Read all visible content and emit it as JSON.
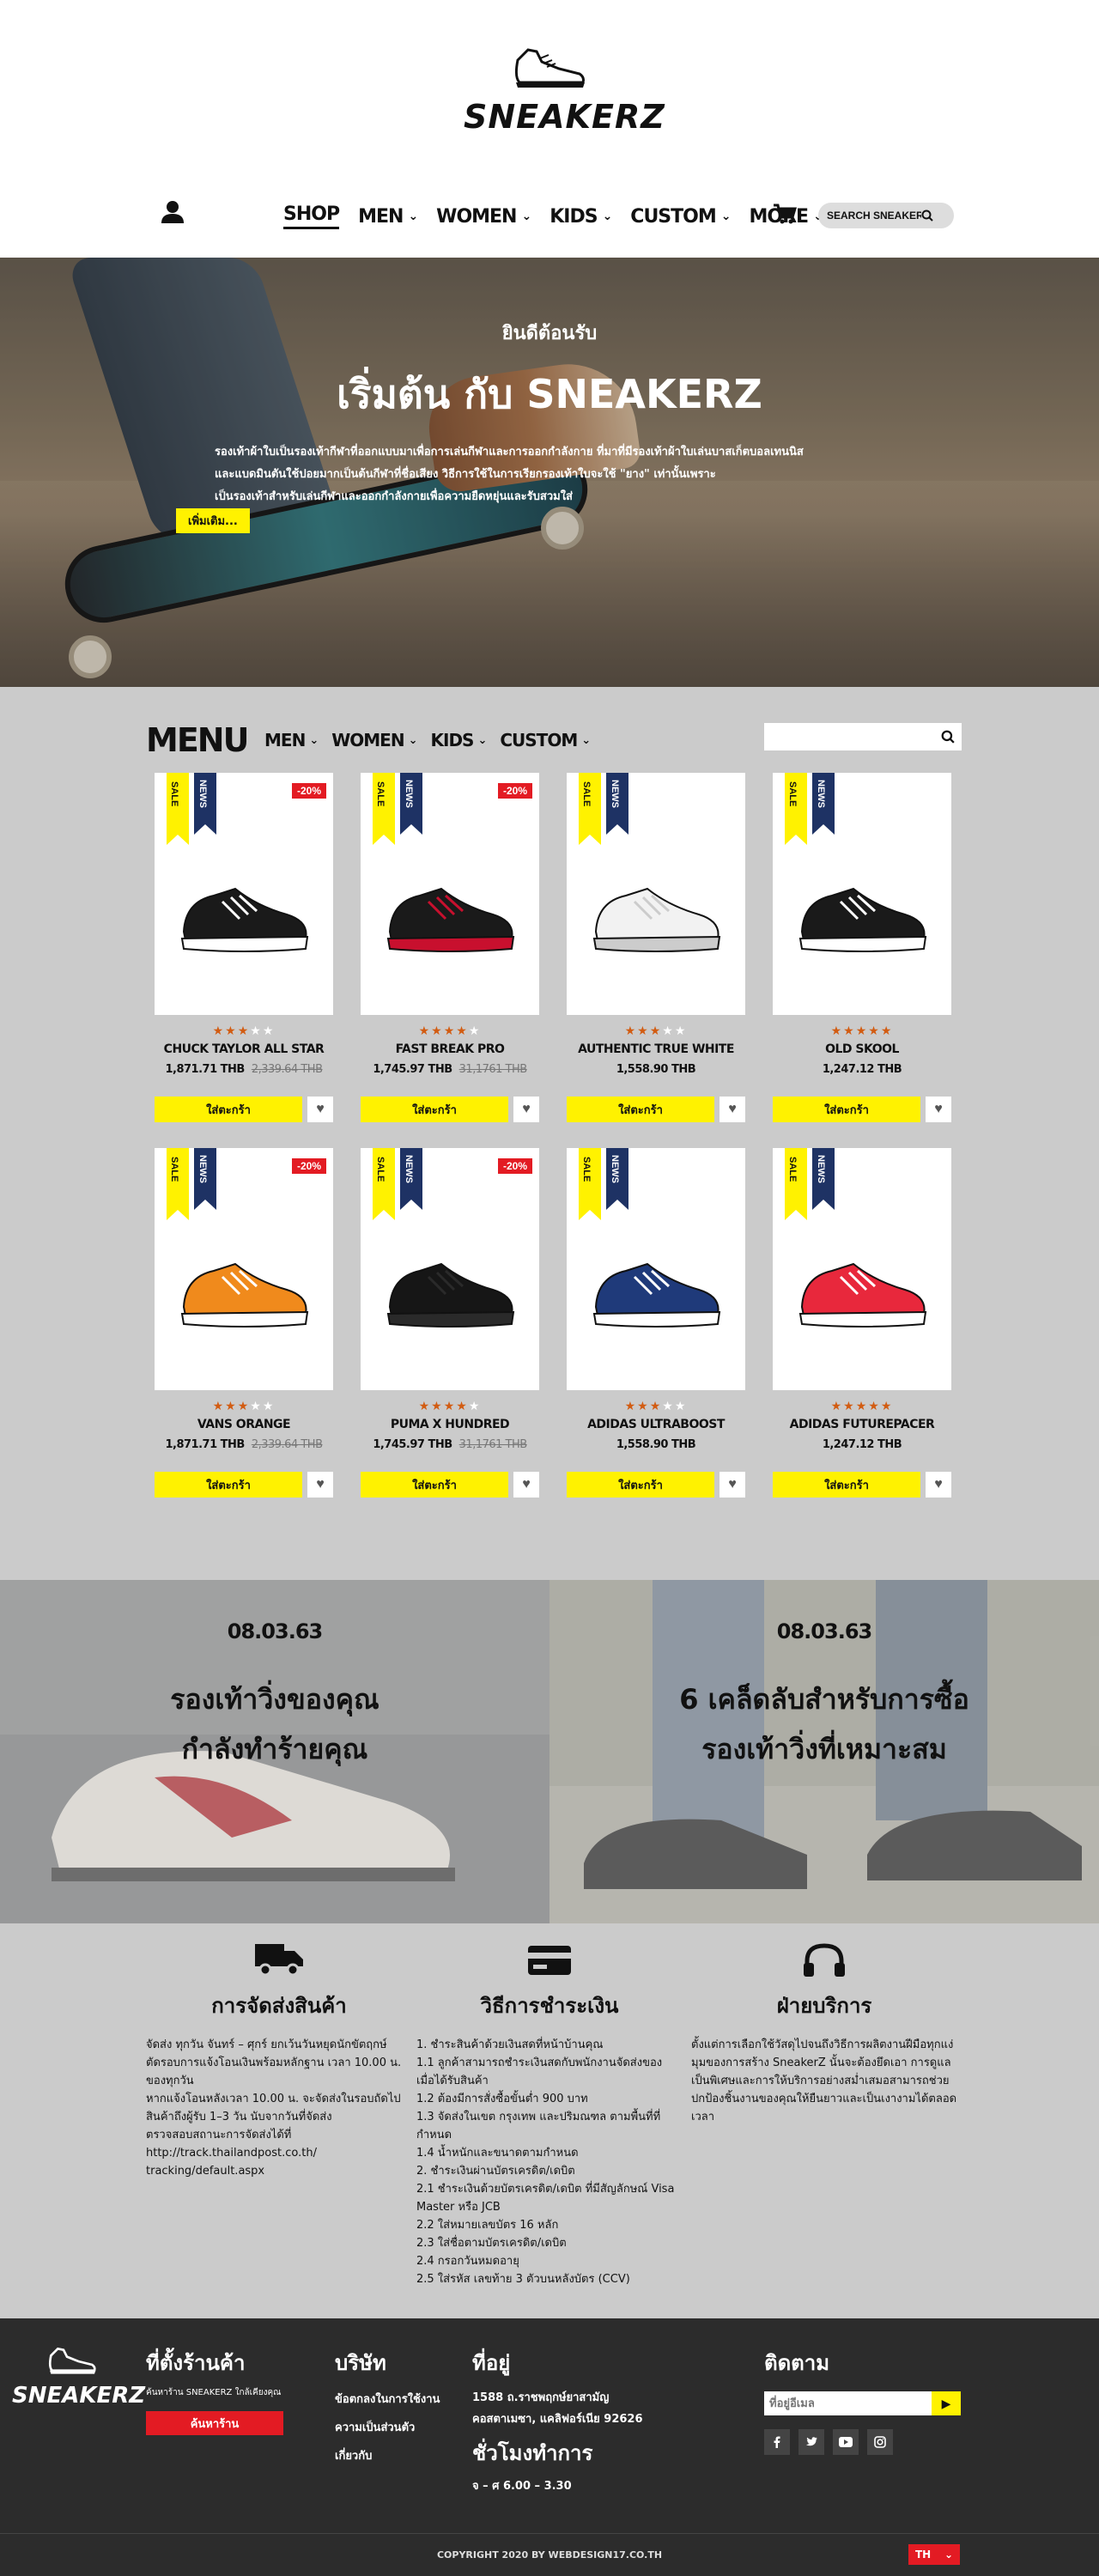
{
  "brand": {
    "name": "SNEAKERZ"
  },
  "nav": {
    "items": [
      {
        "label": "SHOP",
        "chevron": false
      },
      {
        "label": "MEN",
        "chevron": true
      },
      {
        "label": "WOMEN",
        "chevron": true
      },
      {
        "label": "KIDS",
        "chevron": true
      },
      {
        "label": "CUSTOM",
        "chevron": true
      },
      {
        "label": "MORE",
        "chevron": true
      }
    ],
    "search_placeholder": "SEARCH SNEAKERZ"
  },
  "hero": {
    "welcome": "ยินดีต้อนรับ",
    "title": "เริ่มต้น กับ SNEAKERZ",
    "description_lines": [
      "รองเท้าผ้าใบเป็นรองเท้ากีฬาที่ออกแบบมาเพื่อการเล่นกีฬาและการออกกำลังกาย ที่มาที่มีรองเท้าผ้าใบเล่นบาสเก็ตบอลเทนนิส",
      "และแบดมินตันใช้ปอยมากเป็นต้นกีฬาที่ชื่อเสียง วิธีการใช้ในการเรียกรองเท้าใบจะใช้ \"ยาง\" เท่านั้นเพราะ",
      "เป็นรองเท้าสำหรับเล่นกีฬาและออกกำลังกายเพื่อความยืดหยุ่นและรับสวมใส่"
    ],
    "button": "เพิ่มเติม..."
  },
  "menu": {
    "title": "MENU",
    "nav": [
      "MEN",
      "WOMEN",
      "KIDS",
      "CUSTOM"
    ],
    "search_placeholder": ""
  },
  "products": [
    {
      "name": "CHUCK TAYLOR ALL STAR",
      "price": "1,871.71 THB",
      "old_price": "2,339.64 THB",
      "discount": "-20%",
      "rating": 3,
      "color": "#1a1a1a",
      "accent": "#ffffff"
    },
    {
      "name": "FAST BREAK PRO",
      "price": "1,745.97 THB",
      "old_price": "31,1761 THB",
      "discount": "-20%",
      "rating": 4,
      "color": "#1a1a1a",
      "accent": "#c8102e"
    },
    {
      "name": "AUTHENTIC TRUE WHITE",
      "price": "1,558.90 THB",
      "old_price": "",
      "discount": "",
      "rating": 3,
      "color": "#f2f2f2",
      "accent": "#cccccc"
    },
    {
      "name": "OLD SKOOL",
      "price": "1,247.12 THB",
      "old_price": "",
      "discount": "",
      "rating": 5,
      "color": "#1a1a1a",
      "accent": "#ffffff"
    },
    {
      "name": "VANS ORANGE",
      "price": "1,871.71 THB",
      "old_price": "2,339.64 THB",
      "discount": "-20%",
      "rating": 3,
      "color": "#f08a1c",
      "accent": "#ffffff"
    },
    {
      "name": "PUMA X HUNDRED",
      "price": "1,745.97 THB",
      "old_price": "31,1761 THB",
      "discount": "-20%",
      "rating": 4,
      "color": "#161616",
      "accent": "#2a2a2a"
    },
    {
      "name": "ADIDAS ULTRABOOST",
      "price": "1,558.90 THB",
      "old_price": "",
      "discount": "",
      "rating": 3,
      "color": "#1f3a7a",
      "accent": "#ffffff"
    },
    {
      "name": "ADIDAS FUTUREPACER",
      "price": "1,247.12 THB",
      "old_price": "",
      "discount": "",
      "rating": 5,
      "color": "#e8283c",
      "accent": "#ffffff"
    }
  ],
  "labels": {
    "sale": "SALE",
    "news": "NEWS",
    "add_to_cart": "ใส่ตะกร้า"
  },
  "blog": [
    {
      "date": "08.03.63",
      "title": "รองเท้าวิ่งของคุณ\nกำลังทำร้ายคุณ"
    },
    {
      "date": "08.03.63",
      "title": "6 เคล็ดลับสำหรับการซื้อ\nรองเท้าวิ่งที่เหมาะสม"
    }
  ],
  "info": {
    "shipping": {
      "title": "การจัดส่งสินค้า",
      "lines": [
        "จัดส่ง ทุกวัน จันทร์ – ศุกร์ ยกเว้นวันหยุดนักขัตฤกษ์",
        "ตัดรอบการแจ้งโอนเงินพร้อมหลักฐาน เวลา 10.00 น. ของทุกวัน",
        "หากแจ้งโอนหลังเวลา 10.00 น. จะจัดส่งในรอบถัดไป",
        "สินค้าถึงผู้รับ 1–3 วัน นับจากวันที่จัดส่ง",
        "ตรวจสอบสถานะการจัดส่งได้ที่",
        "http://track.thailandpost.co.th/ tracking/default.aspx"
      ]
    },
    "payment": {
      "title": "วิธีการชำระเงิน",
      "lines": [
        "1. ชำระสินค้าด้วยเงินสดที่หน้าบ้านคุณ",
        "1.1 ลูกค้าสามารถชำระเงินสดกับพนักงานจัดส่งของ เมื่อได้รับสินค้า",
        "1.2 ต้องมีการสั่งซื้อขั้นต่ำ 900 บาท",
        "1.3 จัดส่งในเขต กรุงเทพ และปริมณฑล ตามพื้นที่ที่กำหนด",
        "1.4 น้ำหนักและขนาดตามกำหนด",
        "2. ชำระเงินผ่านบัตรเครดิต/เดบิต",
        "2.1 ชำระเงินด้วยบัตรเครดิต/เดบิต ที่มีสัญลักษณ์ Visa Master หรือ JCB",
        "2.2 ใส่หมายเลขบัตร 16 หลัก",
        "2.3 ใส่ชื่อตามบัตรเครดิต/เดบิต",
        "2.4 กรอกวันหมดอายุ",
        "2.5 ใส่รหัส เลขท้าย 3 ตัวบนหลังบัตร (CCV)"
      ]
    },
    "service": {
      "title": "ฝ่ายบริการ",
      "lines": [
        "ตั้งแต่การเลือกใช้วัสดุไปจนถึงวิธีการผลิตงานฝีมือทุกแง่มุมของการสร้าง SneakerZ นั้นจะต้องยึดเอา การดูแลเป็นพิเศษและการให้บริการอย่างสม่ำเสมอสามารถช่วยปกป้องชิ้นงานของคุณให้ยืนยาวและเป็นเงางามได้ตลอดเวลา"
      ]
    }
  },
  "footer": {
    "store": {
      "title": "ที่ตั้งร้านค้า",
      "sub": "ค้นหาร้าน SNEAKERZ ใกล้เคียงคุณ",
      "button": "ค้นหาร้าน"
    },
    "company": {
      "title": "บริษัท",
      "links": [
        "ข้อตกลงในการใช้งาน",
        "ความเป็นส่วนตัว",
        "เกี่ยวกับ"
      ]
    },
    "address": {
      "title": "ที่อยู่",
      "lines": [
        "1588 ถ.ราชพฤกษ์ยาสามัญ",
        "คอสตาเมซา, แคลิฟอร์เนีย 92626"
      ],
      "hours_title": "ชั่วโมงทำการ",
      "hours": "จ – ศ 6.00 – 3.30"
    },
    "follow": {
      "title": "ติดตาม",
      "email_placeholder": "ที่อยู่อีเมล"
    },
    "copyright": "COPYRIGHT 2020 BY WEBDESIGN17.CO.TH",
    "lang": "TH"
  }
}
